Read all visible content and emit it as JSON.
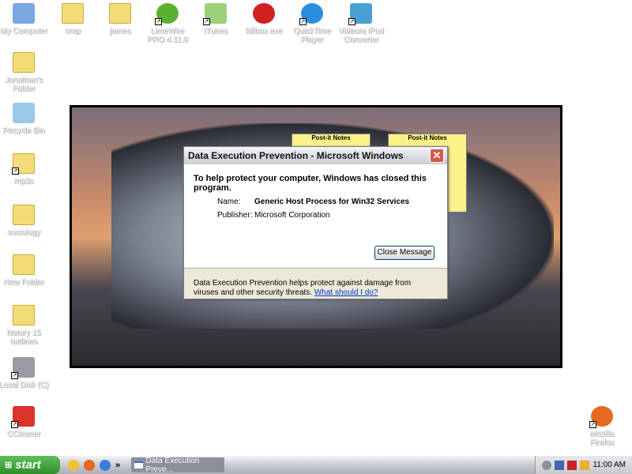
{
  "desktop": {
    "top_icons": [
      {
        "label": "My Computer",
        "icon": "computer-icon"
      },
      {
        "label": "crap",
        "icon": "folder-icon"
      },
      {
        "label": "james",
        "icon": "folder-icon"
      },
      {
        "label": "LimeWire PRO 4.11.0",
        "icon": "limewire-icon",
        "shortcut": true
      },
      {
        "label": "iTunes",
        "icon": "itunes-icon",
        "shortcut": true
      },
      {
        "label": "killbox.exe",
        "icon": "error-icon"
      },
      {
        "label": "QuickTime Player",
        "icon": "quicktime-icon",
        "shortcut": true
      },
      {
        "label": "Videora iPod Converter",
        "icon": "videora-icon",
        "shortcut": true
      }
    ],
    "left_icons": [
      {
        "label": "Jonathan's Folder",
        "icon": "folder-icon"
      },
      {
        "label": "Recycle Bin",
        "icon": "recycle-bin-icon"
      },
      {
        "label": "mp3s",
        "icon": "folder-icon",
        "shortcut": true
      },
      {
        "label": "sociology",
        "icon": "folder-icon"
      },
      {
        "label": "New Folder",
        "icon": "folder-icon"
      },
      {
        "label": "history 15 outlines",
        "icon": "folder-icon"
      },
      {
        "label": "Local Disk (C)",
        "icon": "drive-icon",
        "shortcut": true
      },
      {
        "label": "CCleaner",
        "icon": "ccleaner-icon",
        "shortcut": true
      }
    ],
    "right_icons": [
      {
        "label": "Mozilla Firefox",
        "icon": "firefox-icon",
        "shortcut": true
      }
    ]
  },
  "notes": [
    {
      "label": "Post-it Notes"
    },
    {
      "label": "Post-it Notes"
    }
  ],
  "dialog": {
    "title": "Data Execution Prevention - Microsoft Windows",
    "heading": "To help protect your computer, Windows has closed this program.",
    "name_label": "Name:",
    "name_value": "Generic Host Process for Win32 Services",
    "publisher_label": "Publisher:",
    "publisher_value": "Microsoft Corporation",
    "close_button": "Close Message",
    "info": "Data Execution Prevention helps protect against damage from viruses and other security threats.",
    "link": "What should I do?"
  },
  "taskbar": {
    "start": "start",
    "quicklaunch_more": "»",
    "task": "Data Execution Preve...",
    "clock": "11:00 AM"
  }
}
